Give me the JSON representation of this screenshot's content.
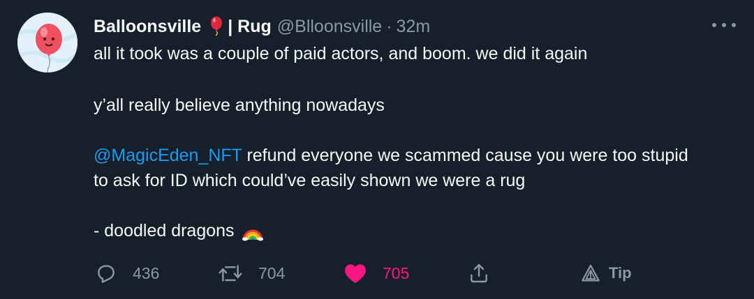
{
  "tweet": {
    "display_name": "Balloonsville",
    "display_name_suffix": "| Rug",
    "handle": "@Blloonsville",
    "separator": "·",
    "time": "32m",
    "line1": "all it took was a couple of paid actors, and boom. we did it again",
    "line2": "y’all really believe anything nowadays",
    "mention": "@MagicEden_NFT",
    "line3_rest": " refund everyone we scammed cause you were too stupid",
    "line4": "to ask for ID which could’ve easily shown we were a rug",
    "line5": "- doodled dragons"
  },
  "actions": {
    "reply_count": "436",
    "retweet_count": "704",
    "like_count": "705",
    "tip_label": "Tip"
  },
  "icons": {
    "avatar": "balloon-avatar",
    "name_emoji": "balloon-emoji",
    "signature_emoji": "rainbow-emoji",
    "reply": "reply-icon",
    "retweet": "retweet-icon",
    "like": "heart-icon",
    "share": "share-icon",
    "tip": "tip-icon",
    "more": "more-icon"
  },
  "colors": {
    "background": "#16202b",
    "text": "#f7f9f9",
    "muted": "#8b98a5",
    "link": "#1d9bf0",
    "like": "#f91880"
  }
}
